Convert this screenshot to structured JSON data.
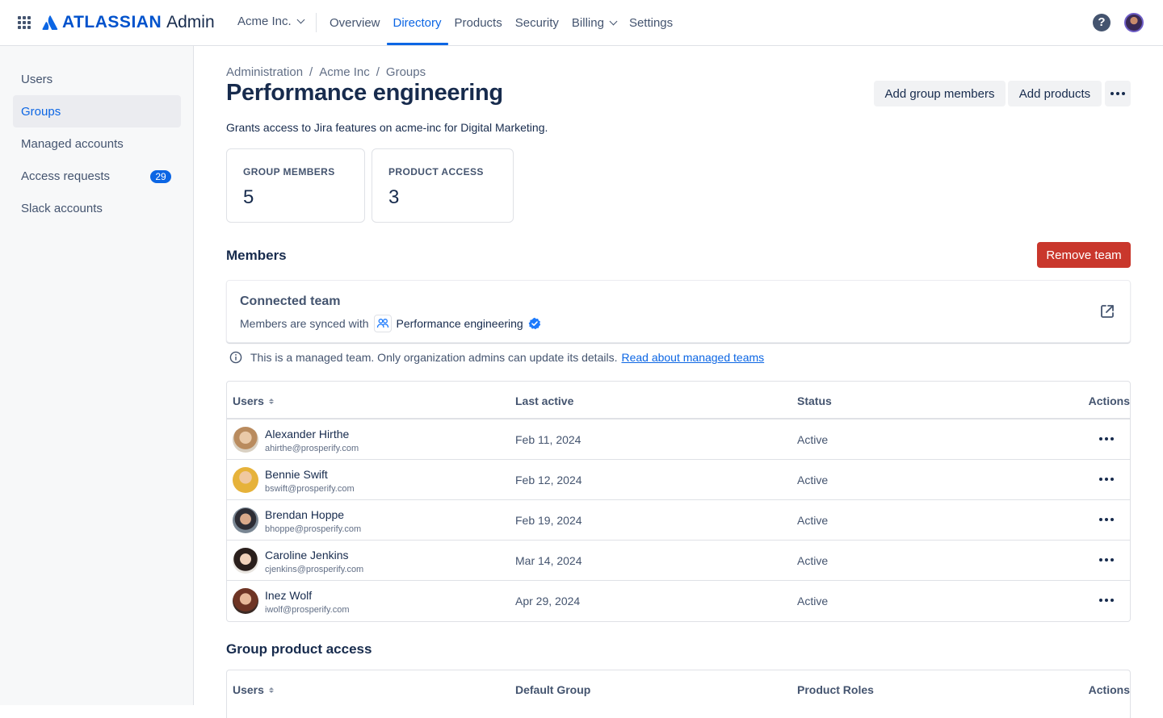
{
  "nav": {
    "brand": "ATLASSIAN",
    "product": "Admin",
    "org": "Acme Inc.",
    "items": [
      {
        "label": "Overview"
      },
      {
        "label": "Directory",
        "active": true
      },
      {
        "label": "Products"
      },
      {
        "label": "Security"
      },
      {
        "label": "Billing",
        "dropdown": true
      },
      {
        "label": "Settings"
      }
    ],
    "help_glyph": "?"
  },
  "sidebar": {
    "items": [
      {
        "label": "Users"
      },
      {
        "label": "Groups",
        "active": true
      },
      {
        "label": "Managed accounts"
      },
      {
        "label": "Access requests",
        "badge": "29"
      },
      {
        "label": "Slack accounts"
      }
    ]
  },
  "breadcrumb": [
    "Administration",
    "Acme Inc",
    "Groups"
  ],
  "page": {
    "title": "Performance engineering",
    "description": "Grants access to Jira features on acme-inc for Digital Marketing.",
    "add_members_label": "Add group members",
    "add_products_label": "Add products"
  },
  "stats": [
    {
      "label": "GROUP MEMBERS",
      "value": "5"
    },
    {
      "label": "PRODUCT ACCESS",
      "value": "3"
    }
  ],
  "members": {
    "heading": "Members",
    "remove_team_label": "Remove team",
    "connected_team": {
      "heading": "Connected team",
      "synced_prefix": "Members are synced with",
      "team_name": "Performance engineering"
    },
    "notice": {
      "text": "This is a managed team. Only organization admins can update its details.",
      "link": "Read about managed teams"
    },
    "columns": [
      "Users",
      "Last active",
      "Status",
      "Actions"
    ],
    "rows": [
      {
        "name": "Alexander Hirthe",
        "email": "ahirthe@prosperify.com",
        "last_active": "Feb 11, 2024",
        "status": "Active"
      },
      {
        "name": "Bennie Swift",
        "email": "bswift@prosperify.com",
        "last_active": "Feb 12, 2024",
        "status": "Active"
      },
      {
        "name": "Brendan Hoppe",
        "email": "bhoppe@prosperify.com",
        "last_active": "Feb 19, 2024",
        "status": "Active"
      },
      {
        "name": "Caroline Jenkins",
        "email": "cjenkins@prosperify.com",
        "last_active": "Mar 14, 2024",
        "status": "Active"
      },
      {
        "name": "Inez Wolf",
        "email": "iwolf@prosperify.com",
        "last_active": "Apr 29, 2024",
        "status": "Active"
      }
    ]
  },
  "product_access": {
    "heading": "Group product access",
    "columns": [
      "Users",
      "Default Group",
      "Product Roles",
      "Actions"
    ]
  },
  "colors": {
    "accent": "#0c66e4",
    "danger": "#c9372c",
    "text": "#172b4d",
    "subtle": "#44546f"
  }
}
